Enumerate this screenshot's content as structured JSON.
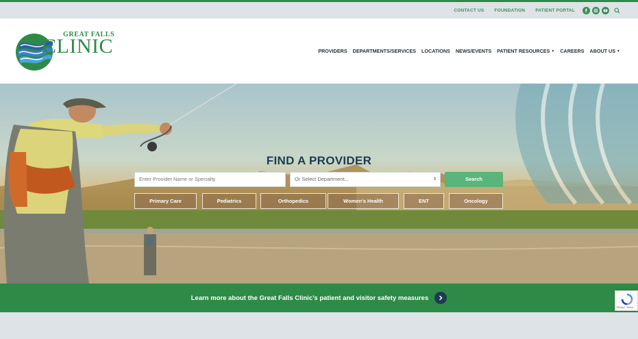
{
  "utility": {
    "links": [
      "CONTACT US",
      "FOUNDATION",
      "PATIENT PORTAL"
    ],
    "icons": [
      "facebook-icon",
      "instagram-icon",
      "youtube-icon",
      "search-icon"
    ]
  },
  "logo": {
    "line1": "GREAT FALLS",
    "line2": "CLINIC"
  },
  "nav": {
    "items": [
      "PROVIDERS",
      "DEPARTMENTS/SERVICES",
      "LOCATIONS",
      "NEWS/EVENTS",
      "PATIENT RESOURCES",
      "CAREERS",
      "ABOUT US"
    ]
  },
  "hero": {
    "title": "FIND A PROVIDER",
    "provider_placeholder": "Enter Provider Name or Specialty",
    "department_placeholder": "Or Select Department...",
    "search_label": "Search",
    "specialties": [
      "Primary Care",
      "Pediatrics",
      "Orthopedics",
      "Women's Health",
      "ENT",
      "Oncology"
    ]
  },
  "banner": {
    "text": "Learn more about the Great Falls Clinic’s patient and visitor safety measures"
  },
  "recaptcha": {
    "terms": "Privacy - Terms"
  },
  "colors": {
    "brand_green": "#2e8b47",
    "navy": "#1f3a52",
    "search_green": "#59b57a"
  }
}
